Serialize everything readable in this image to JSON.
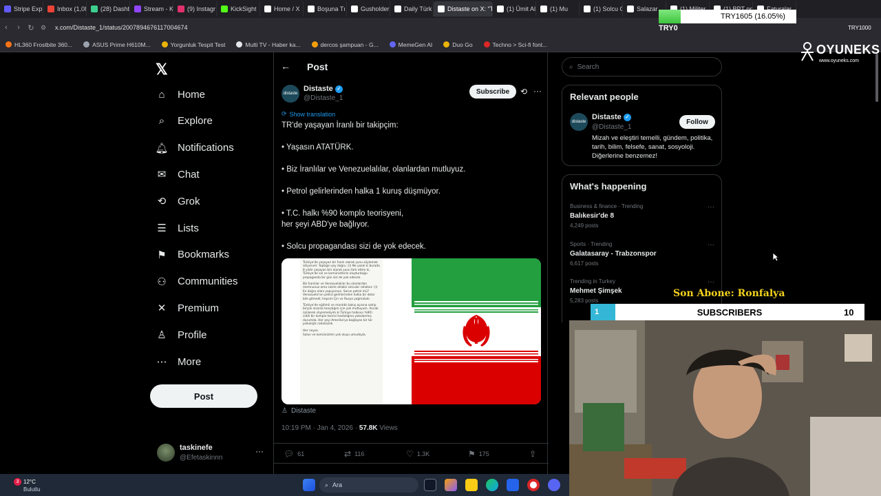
{
  "browser": {
    "tabs": [
      {
        "label": "Stripe Expr",
        "color": "#635bff"
      },
      {
        "label": "Inbox (1,08",
        "color": "#ea4335"
      },
      {
        "label": "(28) Dashb",
        "color": "#3ecf8e"
      },
      {
        "label": "Stream - Ki",
        "color": "#9146ff"
      },
      {
        "label": "(9) Instagr",
        "color": "#e1306c"
      },
      {
        "label": "KickSight",
        "color": "#53fc18"
      },
      {
        "label": "Home / X",
        "color": "#ffffff"
      },
      {
        "label": "Boşuna Tı",
        "color": "#ffffff"
      },
      {
        "label": "Gusholder",
        "color": "#ffffff"
      },
      {
        "label": "Daily Türk",
        "color": "#ffffff"
      },
      {
        "label": "Distaste on X: \"TR",
        "color": "#ffffff",
        "active": true
      },
      {
        "label": "(1) Ümit Al",
        "color": "#ffffff"
      },
      {
        "label": "(1) Mu",
        "color": "#ffffff"
      },
      {
        "label": "(1) Solcu G",
        "color": "#ffffff"
      },
      {
        "label": "Salazar",
        "color": "#ffffff"
      },
      {
        "label": "(1) Militer",
        "color": "#ffffff"
      },
      {
        "label": "(1) BPT on",
        "color": "#ffffff"
      },
      {
        "label": "Faturalar",
        "color": "#ffffff"
      }
    ],
    "url": "x.com/Distaste_1/status/2007894676117004674",
    "bookmarks": [
      {
        "label": "HL360 Frostbite 360...",
        "color": "#f97316"
      },
      {
        "label": "ASUS Prime H610M...",
        "color": "#9ca3af"
      },
      {
        "label": "Yorgunluk Tespit Test",
        "color": "#eab308"
      },
      {
        "label": "Multi TV - Haber ka...",
        "color": "#e5e7eb"
      },
      {
        "label": "dercos şampuan - G...",
        "color": "#f59e0b"
      },
      {
        "label": "MemeGen AI",
        "color": "#6366f1"
      },
      {
        "label": "Duo Go",
        "color": "#eab308"
      },
      {
        "label": "Techno > Sci-fi font...",
        "color": "#dc2626"
      }
    ]
  },
  "overlay": {
    "try_bar_text": "TRY1605 (16.05%)",
    "try_bar_progress": 0.1605,
    "try_label": "TRY0",
    "try_right": "TRY1000",
    "oyuneks_logo": "OYUNEKS",
    "oyuneks_url": "www.oyuneks.com",
    "son_abone": "Son Abone: Ronfalya",
    "subs_count": "1",
    "subs_label": "SUBSCRIBERS",
    "subs_goal": "10"
  },
  "nav": {
    "items": [
      {
        "label": "Home",
        "icon": "home-icon",
        "glyph": "⌂"
      },
      {
        "label": "Explore",
        "icon": "search-icon",
        "glyph": "⌕"
      },
      {
        "label": "Notifications",
        "icon": "bell-icon",
        "glyph": "🔔︎"
      },
      {
        "label": "Chat",
        "icon": "mail-icon",
        "glyph": "✉"
      },
      {
        "label": "Grok",
        "icon": "grok-icon",
        "glyph": "⟲"
      },
      {
        "label": "Lists",
        "icon": "list-icon",
        "glyph": "☰"
      },
      {
        "label": "Bookmarks",
        "icon": "bookmark-icon",
        "glyph": "⚑"
      },
      {
        "label": "Communities",
        "icon": "communities-icon",
        "glyph": "⚇"
      },
      {
        "label": "Premium",
        "icon": "x-icon",
        "glyph": "✕"
      },
      {
        "label": "Profile",
        "icon": "person-icon",
        "glyph": "♙"
      },
      {
        "label": "More",
        "icon": "more-circle-icon",
        "glyph": "⋯"
      }
    ],
    "post_button": "Post",
    "account_name": "taskinefe",
    "account_handle": "@Efetaskinnn"
  },
  "post": {
    "header": "Post",
    "author_name": "Distaste",
    "author_handle": "@Distaste_1",
    "subscribe": "Subscribe",
    "show_translation": "Show translation",
    "lines": [
      "TR'de yaşayan İranlı bir takipçim:",
      "• Yaşasın ATATÜRK.",
      "• Biz İranlılar ve Venezuelalılar, olanlardan mutluyuz.",
      "• Petrol gelirlerinden halka 1 kuruş düşmüyor.",
      "• T.C. halkı %90 komplo teorisyeni,",
      "her şeyi ABD'ye bağlıyor.",
      "• Solcu propagandası sizi de yok edecek."
    ],
    "media_doc": [
      "Türkiye'de yaşayan bir İranlı olarak şunu söylemek istiyorum: Yaptığın şey doğru :))) Ne yazık ki burada 8 yıldır yaşayan biri olarak şunu fark ettim ki, Türkiye'de sol ve komünistlerin oluşturduğu propaganda bir gün sizi de yok edecek.",
      "Biz İranlılar ve Venezuelalılar bu olanlardan memnunuz ama sizcte ahlaklı solcular rahatsız :))) En doğru olanı yapıyorsun. Sorun petrol mü? Venezuela'nın petrol gelirlerinden halka bir dolar bile gitmedi; hepsini Çin ve Rusya yağmaladı.",
      "Türkiye'de eğitimli ve mantıklı bakış açısına sahip birçok insanla tanıştığım için çok mutluyum. Ancak üzülerek söylemeliyim ki Türkiye halkının %90'ı ciddi bir komplo teorisi hastalığına yakalanmış durumda. Her şeyi Amerika'ya bağlayan bir tür psikolojik rahatsızlık.",
      "Her neyse.",
      "Solun ve komünizmin yok oluşu umudoyla."
    ],
    "media_caption": "Distaste",
    "time": "10:19 PM · Jan 4, 2026 · ",
    "views_count": "57.8K",
    "views_label": " Views",
    "replies": "61",
    "reposts": "116",
    "likes": "1.3K",
    "bookmarks": "175"
  },
  "right": {
    "search_placeholder": "Search",
    "relevant_title": "Relevant people",
    "rp_name": "Distaste",
    "rp_handle": "@Distaste_1",
    "follow": "Follow",
    "rp_bio": "Mizah ve eleştiri temelli, gündem, politika, tarih, bilim, felsefe, sanat, sosyoloji. Diğerlerine benzemez!",
    "happening_title": "What's happening",
    "trends": [
      {
        "context": "Business & finance · Trending",
        "title": "Balıkesir'de 8",
        "posts": "4,249 posts"
      },
      {
        "context": "Sports · Trending",
        "title": "Galatasaray - Trabzonspor",
        "posts": "6,617 posts"
      },
      {
        "context": "Trending in Turkey",
        "title": "Mehmet Şimşek",
        "posts": "5,283 posts"
      }
    ]
  },
  "taskbar": {
    "temp": "12°C",
    "weather": "Bulutlu",
    "badge": "3",
    "search": "Ara"
  }
}
